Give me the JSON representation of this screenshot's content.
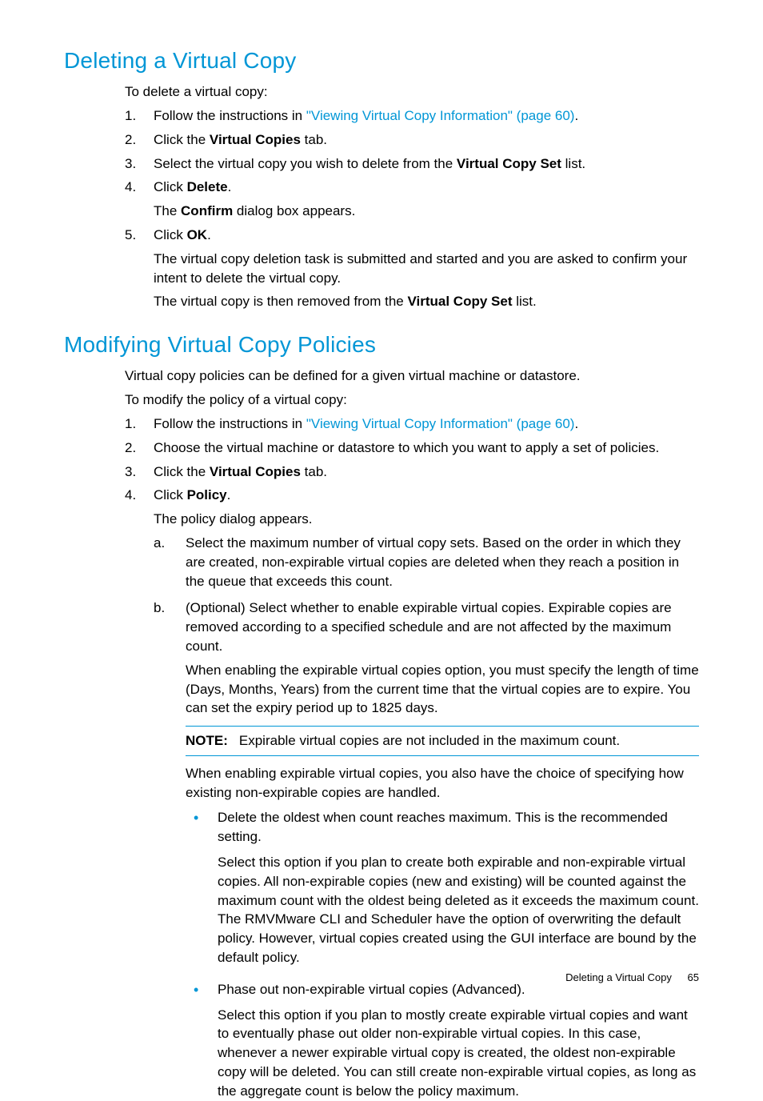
{
  "section1": {
    "heading": "Deleting a Virtual Copy",
    "intro": "To delete a virtual copy:",
    "steps": [
      {
        "num": "1.",
        "parts": [
          {
            "t": "Follow the instructions in "
          },
          {
            "t": "\"Viewing Virtual Copy Information\" (page 60)",
            "link": true
          },
          {
            "t": "."
          }
        ]
      },
      {
        "num": "2.",
        "parts": [
          {
            "t": "Click the "
          },
          {
            "t": "Virtual Copies",
            "bold": true
          },
          {
            "t": " tab."
          }
        ]
      },
      {
        "num": "3.",
        "parts": [
          {
            "t": "Select the virtual copy you wish to delete from the "
          },
          {
            "t": "Virtual Copy Set",
            "bold": true
          },
          {
            "t": " list."
          }
        ]
      },
      {
        "num": "4.",
        "parts": [
          {
            "t": "Click "
          },
          {
            "t": "Delete",
            "bold": true
          },
          {
            "t": "."
          }
        ],
        "after": [
          [
            {
              "t": "The "
            },
            {
              "t": "Confirm",
              "bold": true
            },
            {
              "t": " dialog box appears."
            }
          ]
        ]
      },
      {
        "num": "5.",
        "parts": [
          {
            "t": "Click "
          },
          {
            "t": "OK",
            "bold": true
          },
          {
            "t": "."
          }
        ],
        "after": [
          [
            {
              "t": "The virtual copy deletion task is submitted and started and you are asked to confirm your intent to delete the virtual copy."
            }
          ],
          [
            {
              "t": "The virtual copy is then removed from the "
            },
            {
              "t": "Virtual Copy Set",
              "bold": true
            },
            {
              "t": " list."
            }
          ]
        ]
      }
    ]
  },
  "section2": {
    "heading": "Modifying Virtual Copy Policies",
    "intro1": "Virtual copy policies can be defined for a given virtual machine or datastore.",
    "intro2": "To modify the policy of a virtual copy:",
    "steps": [
      {
        "num": "1.",
        "parts": [
          {
            "t": "Follow the instructions in "
          },
          {
            "t": "\"Viewing Virtual Copy Information\" (page 60)",
            "link": true
          },
          {
            "t": "."
          }
        ]
      },
      {
        "num": "2.",
        "parts": [
          {
            "t": "Choose the virtual machine or datastore to which you want to apply a set of policies."
          }
        ]
      },
      {
        "num": "3.",
        "parts": [
          {
            "t": "Click the "
          },
          {
            "t": "Virtual Copies",
            "bold": true
          },
          {
            "t": " tab."
          }
        ]
      },
      {
        "num": "4.",
        "parts": [
          {
            "t": "Click "
          },
          {
            "t": "Policy",
            "bold": true
          },
          {
            "t": "."
          }
        ],
        "after": [
          [
            {
              "t": "The policy dialog appears."
            }
          ]
        ],
        "substeps": [
          {
            "num": "a.",
            "text": "Select the maximum number of virtual copy sets. Based on the order in which they are created, non-expirable virtual copies are deleted when they reach a position in the queue that exceeds this count."
          },
          {
            "num": "b.",
            "text": "(Optional) Select whether to enable expirable virtual copies. Expirable copies are removed according to a specified schedule and are not affected by the maximum count.",
            "para2": "When enabling the expirable virtual copies option, you must specify the length of time (Days, Months, Years) from the current time that the virtual copies are to expire. You can set the expiry period up to 1825 days.",
            "note_label": "NOTE:",
            "note_text": "Expirable virtual copies are not included in the maximum count.",
            "para3": "When enabling expirable virtual copies, you also have the choice of specifying how existing non-expirable copies are handled.",
            "bullets": [
              {
                "lead": "Delete the oldest when count reaches maximum. This is the recommended setting.",
                "body": "Select this option if you plan to create both expirable and non-expirable virtual copies. All non-expirable copies (new and existing) will be counted against the maximum count with the oldest being deleted as it exceeds the maximum count. The RMVMware CLI and Scheduler have the option of overwriting the default policy. However, virtual copies created using the GUI interface are bound by the default policy."
              },
              {
                "lead": "Phase out non-expirable virtual copies (Advanced).",
                "body": "Select this option if you plan to mostly create expirable virtual copies and want to eventually phase out older non-expirable virtual copies. In this case, whenever a newer expirable virtual copy is created, the oldest non-expirable copy will be deleted. You can still create non-expirable virtual copies, as long as the aggregate count is below the policy maximum."
              }
            ]
          }
        ]
      }
    ]
  },
  "footer": {
    "title": "Deleting a Virtual Copy",
    "page": "65"
  }
}
